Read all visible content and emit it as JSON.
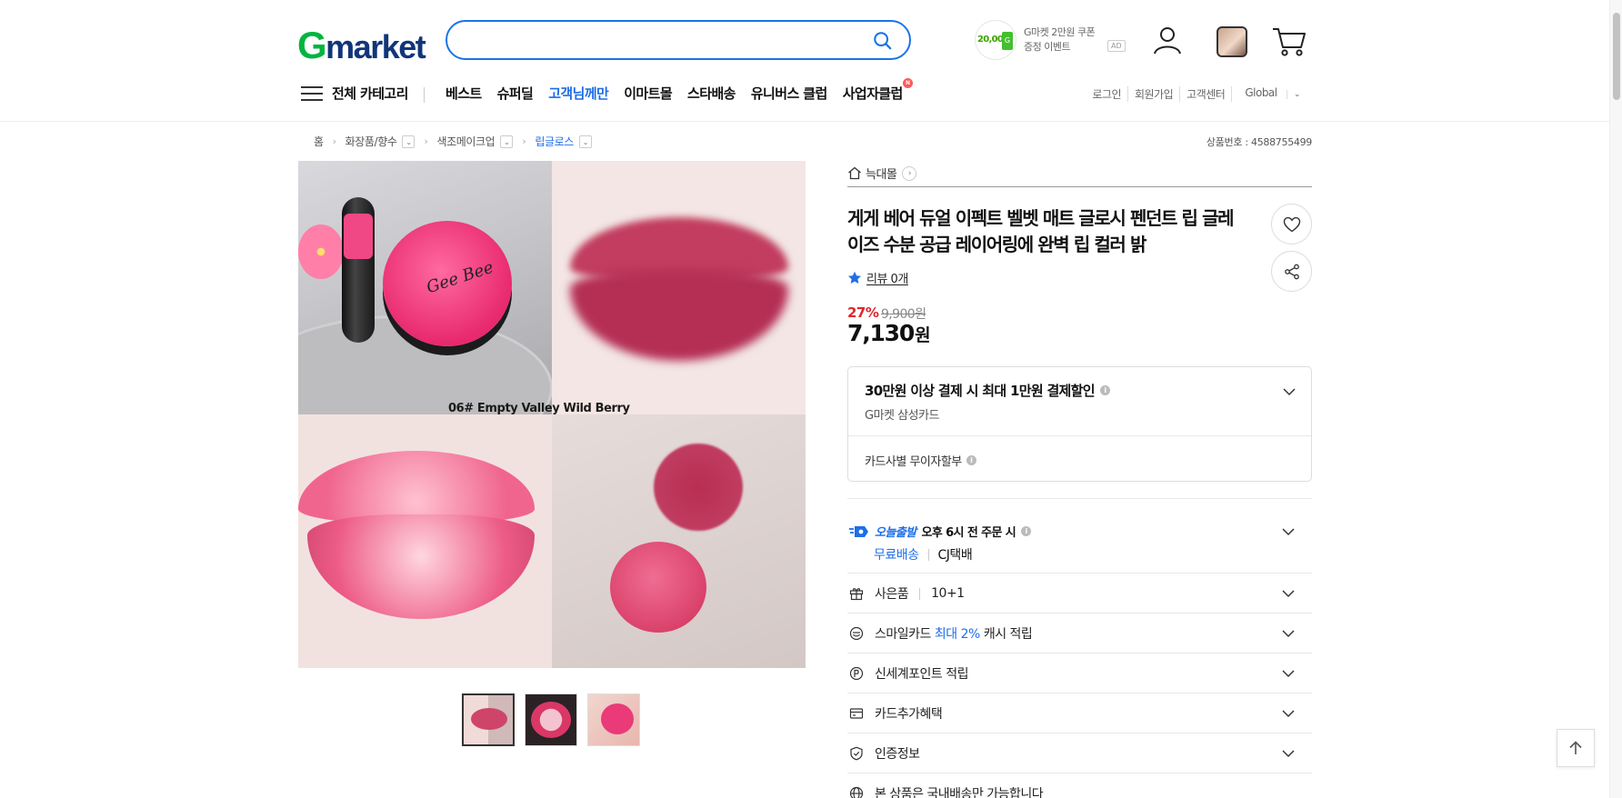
{
  "header": {
    "logo": {
      "first": "G",
      "rest": "market"
    },
    "search": {
      "value": "",
      "placeholder": ""
    },
    "ad": {
      "amount": "20,000",
      "line1": "G마켓 2만원 쿠폰",
      "line2": "증정 이벤트",
      "tag": "AD"
    },
    "icons": [
      "search-icon",
      "user-icon",
      "recent-item-thumbnail",
      "cart-icon"
    ]
  },
  "nav": {
    "menu_label": "전체 카테고리",
    "items": [
      {
        "label": "베스트"
      },
      {
        "label": "슈퍼딜"
      },
      {
        "label": "고객님께만"
      },
      {
        "label": "이마트몰"
      },
      {
        "label": "스타배송"
      },
      {
        "label": "유니버스 클럽"
      },
      {
        "label": "사업자클럽"
      }
    ],
    "new_badge": "N",
    "util": [
      "로그인",
      "회원가입",
      "고객센터",
      "Global"
    ]
  },
  "breadcrumb": {
    "items": [
      "홈",
      "화장품/향수",
      "색조메이크업",
      "립글로스"
    ],
    "product_no_label": "상품번호 : 4588755499"
  },
  "gallery": {
    "caption": "06# Empty Valley Wild Berry",
    "compact_text": "Gee Bee",
    "thumbnails": 3,
    "active_thumb": 0
  },
  "product": {
    "store": "늑대몰",
    "title": "게게 베어 듀얼 이펙트 벨벳 매트 글로시 펜던트 립 글레이즈 수분 공급 레이어링에 완벽 립 컬러 밝",
    "review": "리뷰 0개",
    "discount": "27%",
    "original_price": "9,900원",
    "price": "7,130",
    "currency": "원"
  },
  "card_benefit": {
    "title": "30만원 이상 결제 시 최대 1만원 결제할인",
    "subtitle": "G마켓 삼성카드",
    "installment": "카드사별 무이자할부"
  },
  "shipping": {
    "today_label": "오늘출발",
    "cutoff": "오후 6시 전 주문 시",
    "free": "무료배송",
    "courier": "CJ택배"
  },
  "accordions": [
    {
      "icon": "gift-icon",
      "label": "사은품",
      "value": "10+1"
    },
    {
      "icon": "smile-card-icon",
      "label": "스마일카드",
      "highlight": "최대 2%",
      "suffix": "캐시 적립"
    },
    {
      "icon": "point-icon",
      "label": "신세계포인트 적립"
    },
    {
      "icon": "card-icon",
      "label": "카드추가혜택"
    },
    {
      "icon": "shield-check-icon",
      "label": "인증정보"
    },
    {
      "icon": "globe-icon",
      "label": "본 상품은 국내배송만 가능합니다"
    }
  ],
  "colors": {
    "accent": "#1e6ee8",
    "logo_green": "#00b53f",
    "logo_navy": "#11357a",
    "discount_red": "#e0262a"
  }
}
